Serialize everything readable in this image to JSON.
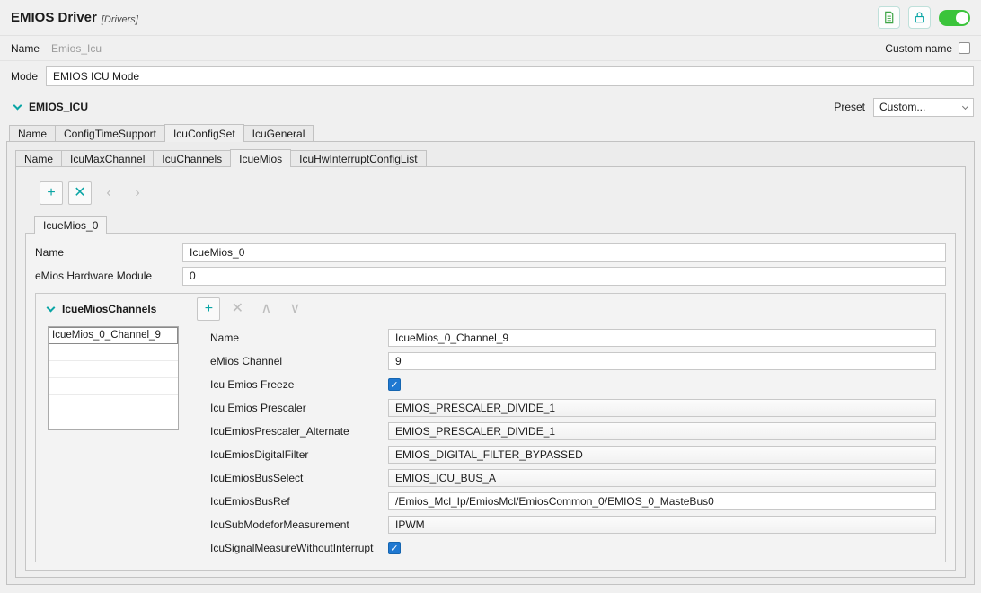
{
  "colors": {
    "accent_teal": "#0aa5a5",
    "toggle_green": "#3bc43b",
    "icon_green": "#3fa546",
    "checkbox_blue": "#1f78d1"
  },
  "header": {
    "title": "EMIOS Driver",
    "subtitle": "[Drivers]",
    "icons": [
      {
        "name": "document-icon"
      },
      {
        "name": "lock-icon"
      },
      {
        "name": "enable-toggle",
        "state": "on"
      }
    ]
  },
  "name_row": {
    "label": "Name",
    "value": "Emios_Icu",
    "custom_name": {
      "label": "Custom name",
      "checked": false
    }
  },
  "mode_row": {
    "label": "Mode",
    "value": "EMIOS ICU Mode"
  },
  "section": {
    "title": "EMIOS_ICU",
    "preset": {
      "label": "Preset",
      "value": "Custom..."
    }
  },
  "outer_tabs": {
    "items": [
      {
        "label": "Name",
        "selected": false
      },
      {
        "label": "ConfigTimeSupport",
        "selected": false
      },
      {
        "label": "IcuConfigSet",
        "selected": true
      },
      {
        "label": "IcuGeneral",
        "selected": false
      }
    ]
  },
  "inner_tabs": {
    "items": [
      {
        "label": "Name",
        "selected": false
      },
      {
        "label": "IcuMaxChannel",
        "selected": false
      },
      {
        "label": "IcuChannels",
        "selected": false
      },
      {
        "label": "IcueMios",
        "selected": true
      },
      {
        "label": "IcuHwInterruptConfigList",
        "selected": false
      }
    ]
  },
  "mios_toolbar": {
    "buttons": [
      {
        "name": "add",
        "glyph": "+",
        "enabled": true
      },
      {
        "name": "remove",
        "glyph": "✕",
        "enabled": true
      },
      {
        "name": "previous",
        "glyph": "‹",
        "enabled": false
      },
      {
        "name": "next",
        "glyph": "›",
        "enabled": false
      }
    ]
  },
  "mios_tabs": {
    "items": [
      {
        "label": "IcueMios_0",
        "selected": true
      }
    ]
  },
  "mios_form": {
    "name": {
      "label": "Name",
      "value": "IcueMios_0"
    },
    "hw_module": {
      "label": "eMios Hardware Module",
      "value": "0"
    }
  },
  "channels": {
    "title": "IcueMiosChannels",
    "toolbar": {
      "buttons": [
        {
          "name": "add",
          "glyph": "+",
          "enabled": true
        },
        {
          "name": "remove",
          "glyph": "✕",
          "enabled": false
        },
        {
          "name": "move-up",
          "glyph": "∧",
          "enabled": false
        },
        {
          "name": "move-down",
          "glyph": "∨",
          "enabled": false
        }
      ]
    },
    "list": {
      "items": [
        {
          "label": "IcueMios_0_Channel_9",
          "selected": true
        }
      ]
    },
    "form": {
      "rows": [
        {
          "label": "Name",
          "type": "text",
          "value": "IcueMios_0_Channel_9"
        },
        {
          "label": "eMios Channel",
          "type": "text",
          "value": "9"
        },
        {
          "label": "Icu Emios Freeze",
          "type": "checkbox",
          "checked": true
        },
        {
          "label": "Icu Emios Prescaler",
          "type": "combo",
          "value": "EMIOS_PRESCALER_DIVIDE_1"
        },
        {
          "label": "IcuEmiosPrescaler_Alternate",
          "type": "combo",
          "value": "EMIOS_PRESCALER_DIVIDE_1"
        },
        {
          "label": "IcuEmiosDigitalFilter",
          "type": "combo",
          "value": "EMIOS_DIGITAL_FILTER_BYPASSED"
        },
        {
          "label": "IcuEmiosBusSelect",
          "type": "combo",
          "value": "EMIOS_ICU_BUS_A"
        },
        {
          "label": "IcuEmiosBusRef",
          "type": "text",
          "value": "/Emios_Mcl_Ip/EmiosMcl/EmiosCommon_0/EMIOS_0_MasteBus0"
        },
        {
          "label": "IcuSubModeforMeasurement",
          "type": "combo",
          "value": "IPWM"
        },
        {
          "label": "IcuSignalMeasureWithoutInterrupt",
          "type": "checkbox",
          "checked": true
        }
      ]
    }
  }
}
